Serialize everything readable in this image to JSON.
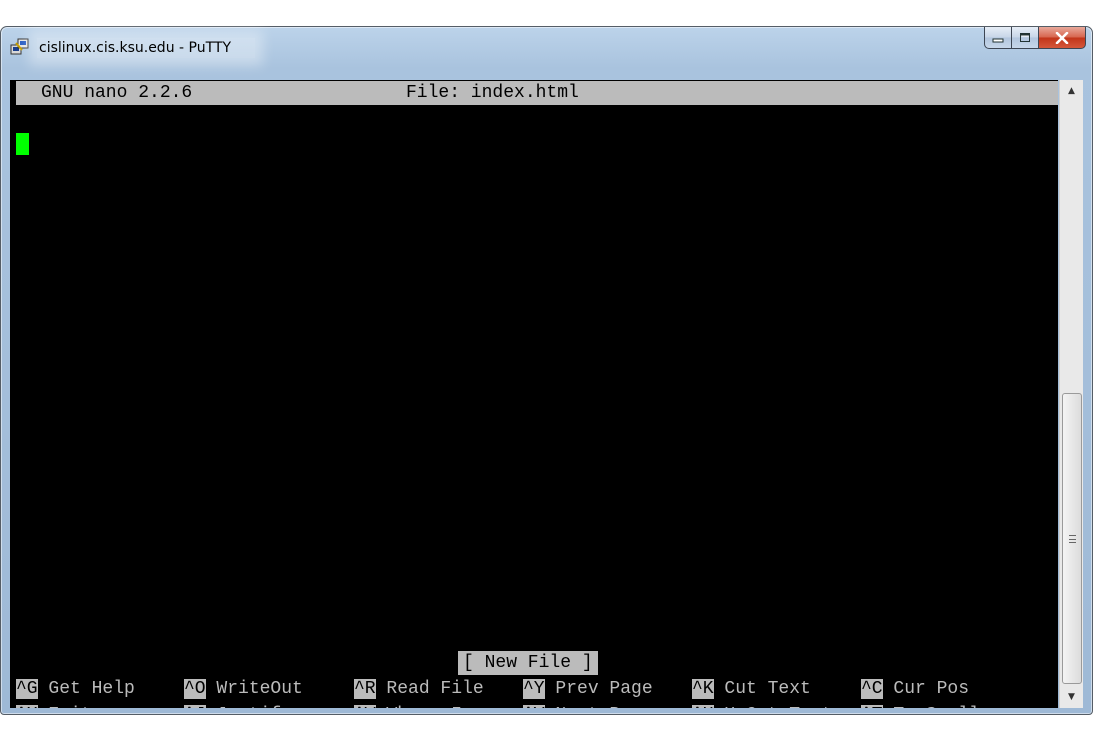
{
  "window": {
    "title": "cislinux.cis.ksu.edu - PuTTY",
    "controls": {
      "minimize_glyph": "▬",
      "maximize_glyph": "□",
      "close_glyph": "X"
    }
  },
  "nano": {
    "header": {
      "version": "GNU nano 2.2.6",
      "file": "File: index.html"
    },
    "status": "[ New File ]",
    "shortcuts_row1": [
      {
        "key": "^G",
        "label": "Get Help"
      },
      {
        "key": "^O",
        "label": "WriteOut"
      },
      {
        "key": "^R",
        "label": "Read File"
      },
      {
        "key": "^Y",
        "label": "Prev Page"
      },
      {
        "key": "^K",
        "label": "Cut Text"
      },
      {
        "key": "^C",
        "label": "Cur Pos"
      }
    ],
    "shortcuts_row2": [
      {
        "key": "^X",
        "label": "Exit"
      },
      {
        "key": "^J",
        "label": "Justify"
      },
      {
        "key": "^W",
        "label": "Where Is"
      },
      {
        "key": "^V",
        "label": "Next Page"
      },
      {
        "key": "^U",
        "label": "UnCut Text"
      },
      {
        "key": "^T",
        "label": "To Spell"
      }
    ]
  },
  "colors": {
    "terminal_bg": "#000000",
    "terminal_fg": "#bbbbbb",
    "cursor": "#00ff00"
  },
  "icons": {
    "app": "putty-icon",
    "scroll_up": "chevron-up-icon",
    "scroll_down": "chevron-down-icon"
  }
}
